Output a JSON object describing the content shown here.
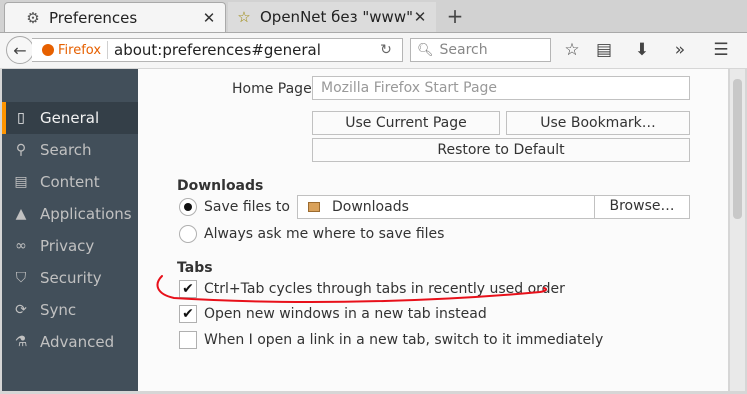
{
  "tabs": [
    {
      "title": "Preferences",
      "icon": "gear-icon",
      "active": true
    },
    {
      "title": "OpenNet без \"www\"…",
      "icon": "star-icon",
      "active": false
    }
  ],
  "navbar": {
    "identity_label": "Firefox",
    "url": "about:preferences#general",
    "search_placeholder": "Search"
  },
  "sidebar": {
    "items": [
      {
        "label": "General",
        "icon": "general-icon",
        "selected": true
      },
      {
        "label": "Search",
        "icon": "search-icon"
      },
      {
        "label": "Content",
        "icon": "content-icon"
      },
      {
        "label": "Applications",
        "icon": "applications-icon"
      },
      {
        "label": "Privacy",
        "icon": "privacy-mask-icon"
      },
      {
        "label": "Security",
        "icon": "shield-icon"
      },
      {
        "label": "Sync",
        "icon": "sync-icon"
      },
      {
        "label": "Advanced",
        "icon": "wizard-hat-icon"
      }
    ]
  },
  "general": {
    "home_page_label": "Home Page:",
    "home_page_placeholder": "Mozilla Firefox Start Page",
    "use_current_page": "Use Current Page",
    "use_bookmark": "Use Bookmark…",
    "restore_default": "Restore to Default",
    "downloads_heading": "Downloads",
    "save_files_to": "Save files to",
    "download_folder": "Downloads",
    "browse": "Browse…",
    "always_ask": "Always ask me where to save files",
    "tabs_heading": "Tabs",
    "ctrl_tab": "Ctrl+Tab cycles through tabs in recently used order",
    "open_new_windows": "Open new windows in a new tab instead",
    "switch_to_tab": "When I open a link in a new tab, switch to it immediately"
  },
  "state": {
    "save_files_to_selected": true,
    "ctrl_tab_checked": true,
    "open_new_windows_checked": true,
    "switch_to_tab_checked": false
  },
  "colors": {
    "sidebar_bg": "#424f5a",
    "sidebar_selected_accent": "#ff9500",
    "annotation_red": "#e8101a"
  }
}
